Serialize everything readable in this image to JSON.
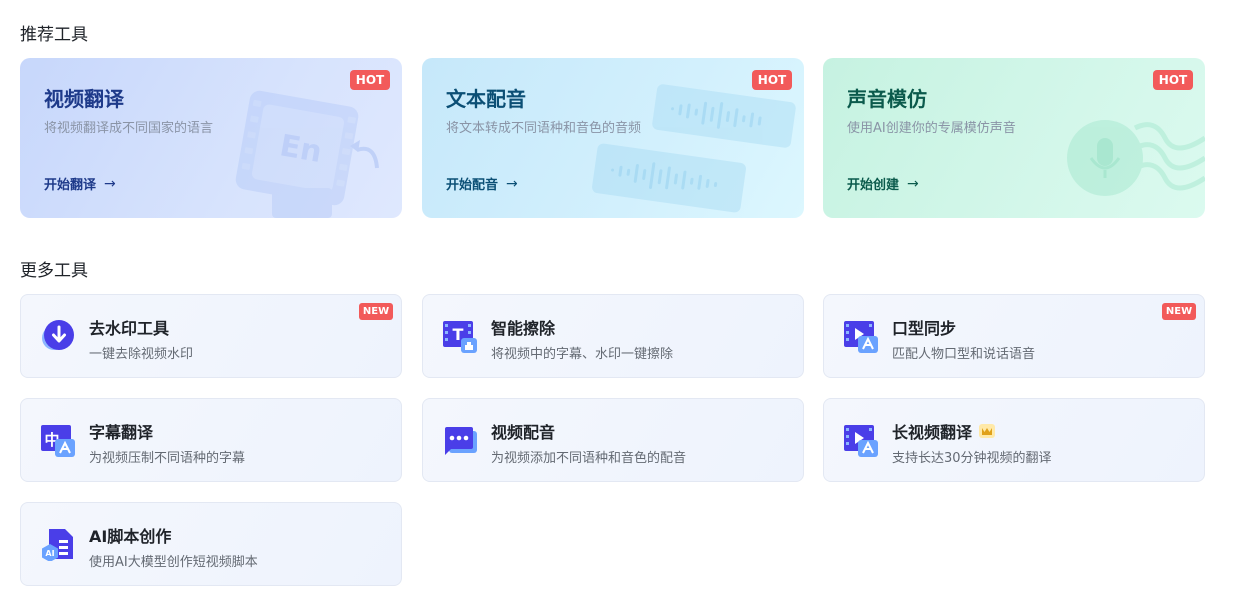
{
  "sections": {
    "recommended_title": "推荐工具",
    "more_title": "更多工具"
  },
  "featured": [
    {
      "title": "视频翻译",
      "desc": "将视频翻译成不同国家的语言",
      "link": "开始翻译",
      "badge": "HOT",
      "icon": "film-en-icon"
    },
    {
      "title": "文本配音",
      "desc": "将文本转成不同语种和音色的音频",
      "link": "开始配音",
      "badge": "HOT",
      "icon": "waveform-icon"
    },
    {
      "title": "声音模仿",
      "desc": "使用AI创建你的专属模仿声音",
      "link": "开始创建",
      "badge": "HOT",
      "icon": "microphone-icon"
    }
  ],
  "arrow": "→",
  "tools": [
    {
      "name": "去水印工具",
      "desc": "一键去除视频水印",
      "badge": "NEW",
      "icon": "download-circle-icon"
    },
    {
      "name": "智能擦除",
      "desc": "将视频中的字幕、水印一键擦除",
      "badge": "",
      "icon": "text-erase-icon"
    },
    {
      "name": "口型同步",
      "desc": "匹配人物口型和说话语音",
      "badge": "NEW",
      "icon": "video-lipsync-icon"
    },
    {
      "name": "字幕翻译",
      "desc": "为视频压制不同语种的字幕",
      "badge": "",
      "icon": "subtitle-translate-icon"
    },
    {
      "name": "视频配音",
      "desc": "为视频添加不同语种和音色的配音",
      "badge": "",
      "icon": "chat-dots-icon"
    },
    {
      "name": "长视频翻译",
      "desc": "支持长达30分钟视频的翻译",
      "badge": "",
      "icon": "video-translate-icon",
      "premium_icon": "crown-icon"
    },
    {
      "name": "AI脚本创作",
      "desc": "使用AI大模型创作短视频脚本",
      "badge": "",
      "icon": "ai-document-icon",
      "icon_text": "AI"
    }
  ],
  "colors": {
    "hot_badge": "#f25a5a",
    "icon_primary": "#4a3ee8",
    "icon_accent": "#6aa2ff"
  }
}
